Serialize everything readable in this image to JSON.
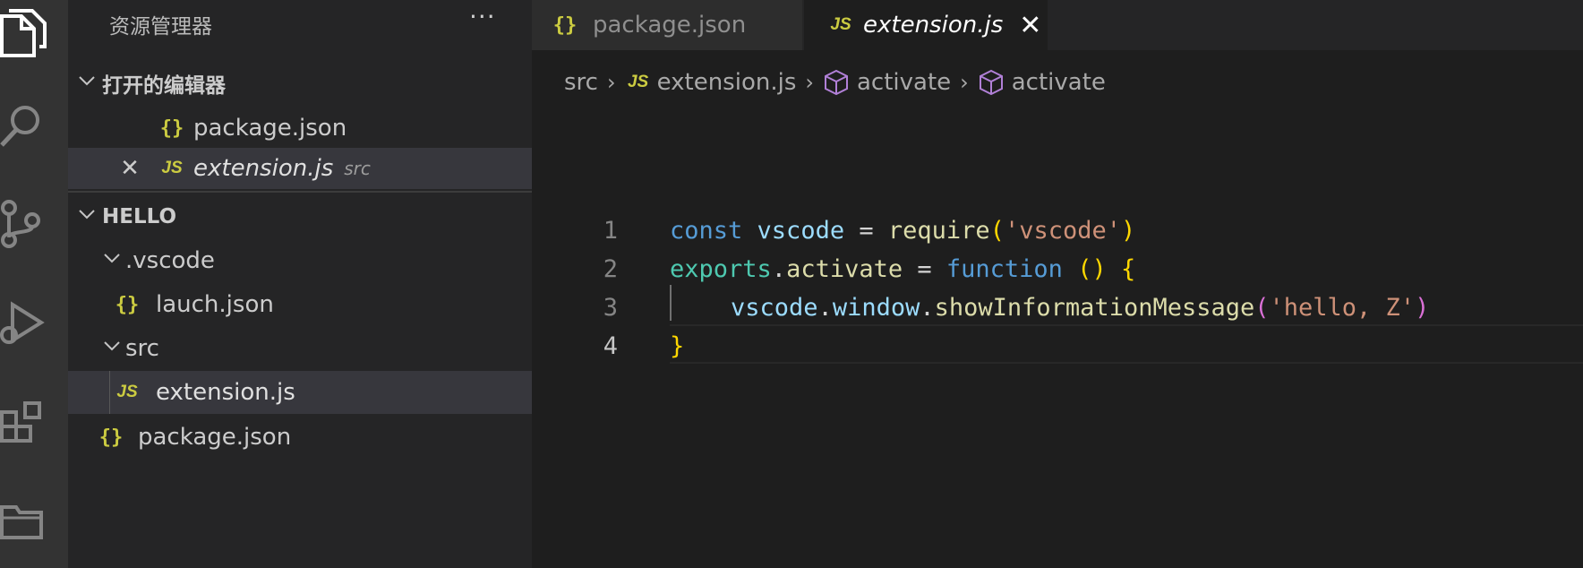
{
  "colors": {
    "activity_bg": "#333333",
    "sidebar_bg": "#252526",
    "editor_bg": "#1e1e1e",
    "json_icon": "#cbcb41",
    "js_icon": "#cbcb41"
  },
  "activity_bar": {
    "icons": [
      "explorer-icon",
      "search-icon",
      "source-control-icon",
      "run-debug-icon",
      "extensions-icon",
      "folder-icon"
    ]
  },
  "sidebar": {
    "title": "资源管理器",
    "more": "···",
    "open_editors": {
      "label": "打开的编辑器",
      "items": [
        {
          "icon": "{}",
          "name": "package.json",
          "desc": ""
        },
        {
          "icon": "JS",
          "name": "extension.js",
          "desc": "src",
          "close": "✕"
        }
      ]
    },
    "workspace": {
      "label": "HELLO",
      "tree": {
        "vscode_folder": ".vscode",
        "launch": {
          "icon": "{}",
          "name": "lauch.json"
        },
        "src_folder": "src",
        "extension": {
          "icon": "JS",
          "name": "extension.js"
        },
        "package": {
          "icon": "{}",
          "name": "package.json"
        }
      }
    }
  },
  "tabs": [
    {
      "icon": "{}",
      "label": "package.json",
      "active": false
    },
    {
      "icon": "JS",
      "label": "extension.js",
      "active": true,
      "close": "✕"
    }
  ],
  "breadcrumb": {
    "folder": "src",
    "file_icon": "JS",
    "file": "extension.js",
    "symbol1": "activate",
    "symbol2": "activate"
  },
  "editor": {
    "lines": [
      {
        "num": "1"
      },
      {
        "num": "2"
      },
      {
        "num": "3"
      },
      {
        "num": "4"
      }
    ],
    "tokens": {
      "l1_const": "const",
      "l1_vscode": "vscode",
      "l1_eq": " = ",
      "l1_require": "require",
      "l1_open": "(",
      "l1_str": "'vscode'",
      "l1_close": ")",
      "l2_exports": "exports",
      "l2_dot": ".",
      "l2_activate": "activate",
      "l2_eq": " = ",
      "l2_function": "function",
      "l2_sp": " ",
      "l2_parens": "()",
      "l2_brace": " {",
      "l3_vscode": "vscode",
      "l3_dot1": ".",
      "l3_window": "window",
      "l3_dot2": ".",
      "l3_method": "showInformationMessage",
      "l3_open": "(",
      "l3_str": "'hello, Z'",
      "l3_close": ")",
      "l4_brace": "}"
    }
  }
}
